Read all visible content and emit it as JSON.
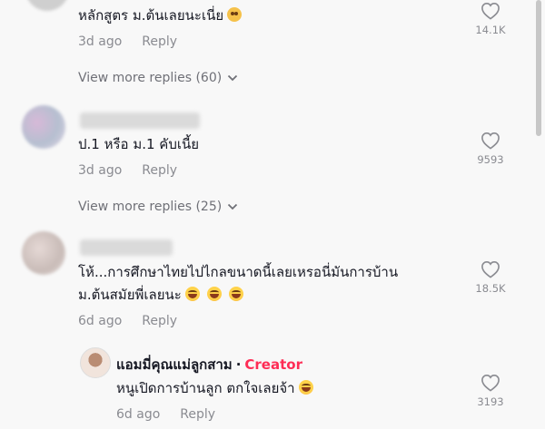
{
  "comments": [
    {
      "text": "หลักสูตร ม.ต้นเลยนะเนี่ย",
      "time": "3d ago",
      "reply_label": "Reply",
      "likes": "14.1K",
      "more_replies": "View more replies (60)"
    },
    {
      "text": "ป.1 หรือ ม.1 คับเนี้ย",
      "time": "3d ago",
      "reply_label": "Reply",
      "likes": "9593",
      "more_replies": "View more replies (25)"
    },
    {
      "text_line1": "โห้...การศึกษาไทยไปไกลขนาดนี้เลยเหรอนี่มันการบ้าน",
      "text_line2": "ม.ต้นสมัยพี่เลยนะ",
      "time": "6d ago",
      "reply_label": "Reply",
      "likes": "18.5K"
    }
  ],
  "creator_reply": {
    "name": "แอมมี่คุณแม่ลูกสาม",
    "separator": "·",
    "badge": "Creator",
    "text": "หนูเปิดการบ้านลูก ตกใจเลยจ้า",
    "time": "6d ago",
    "reply_label": "Reply",
    "likes": "3193"
  },
  "icons": {
    "like": "heart-outline-icon",
    "expand": "chevron-down-icon"
  },
  "colors": {
    "background": "#f8f8f8",
    "creator_badge": "#fe2c55",
    "meta": "#8a8b91"
  }
}
